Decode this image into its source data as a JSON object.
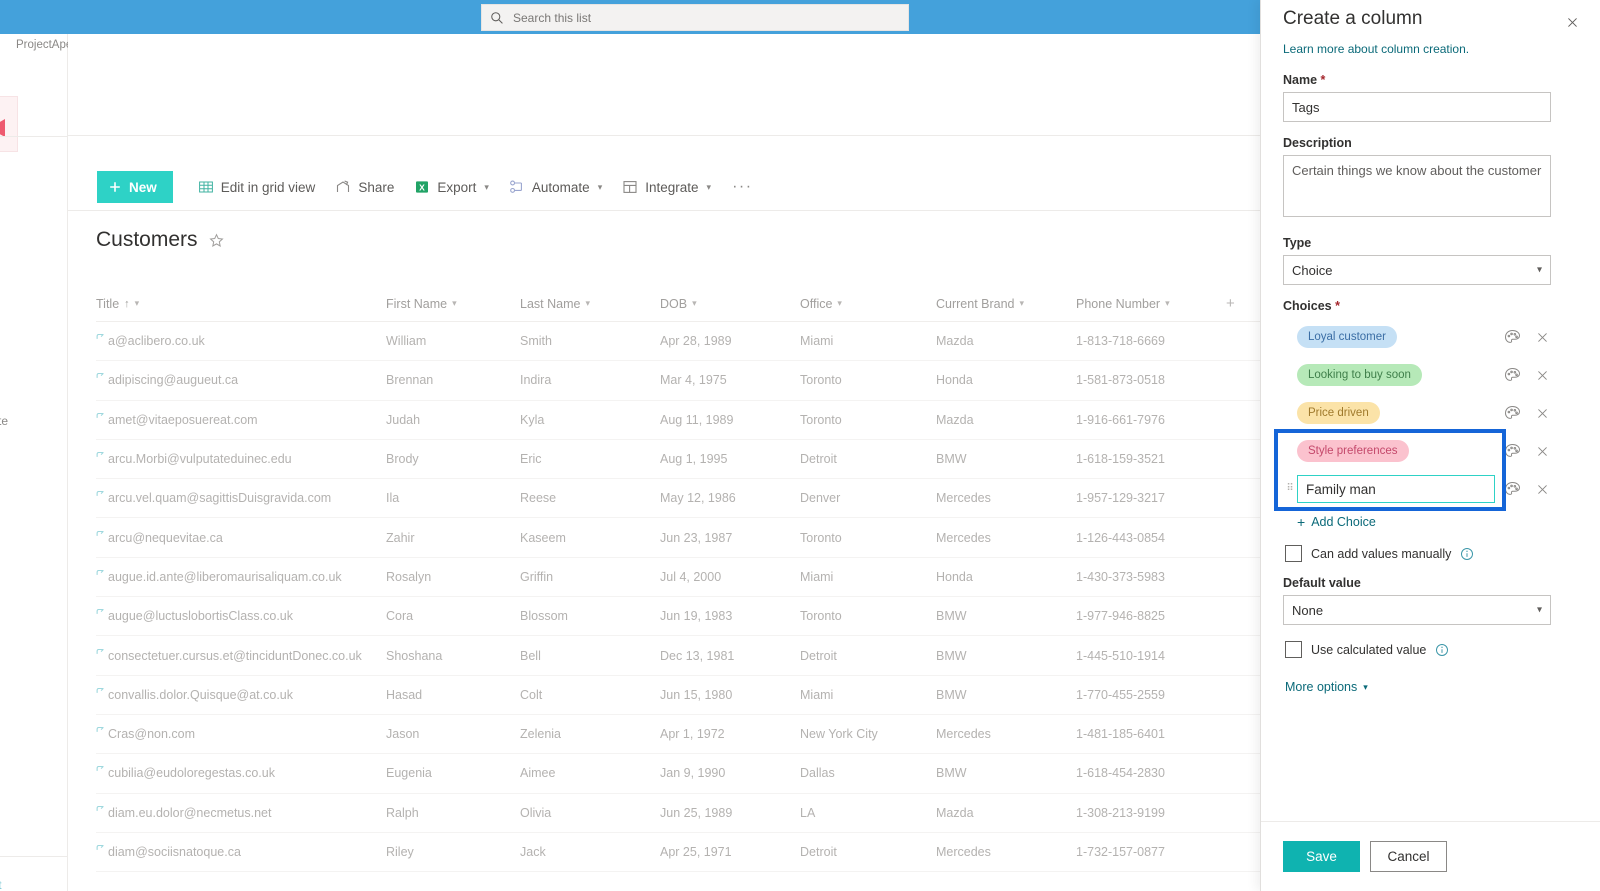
{
  "suite": {
    "search": {
      "placeholder": "Search this list",
      "value": "",
      "icon": "search-icon"
    }
  },
  "sidebar": {
    "site_name": "ProjectApex",
    "clipped_item_1": "mplate",
    "clipped_item_2": "nt"
  },
  "command_bar": {
    "new_label": "New",
    "items": [
      {
        "label": "Edit in grid view",
        "icon": "grid-icon",
        "has_chevron": false
      },
      {
        "label": "Share",
        "icon": "share-icon",
        "has_chevron": false
      },
      {
        "label": "Export",
        "icon": "excel-icon",
        "has_chevron": true
      },
      {
        "label": "Automate",
        "icon": "automate-icon",
        "has_chevron": true
      },
      {
        "label": "Integrate",
        "icon": "integrate-icon",
        "has_chevron": true
      }
    ],
    "overflow_label": "···"
  },
  "list": {
    "title": "Customers",
    "favorite_icon": "star-icon",
    "add_column_label": "+",
    "columns": [
      {
        "label": "Title",
        "sorted": "asc",
        "sort_glyph": "↑"
      },
      {
        "label": "First Name",
        "sorted": "",
        "sort_glyph": ""
      },
      {
        "label": "Last Name",
        "sorted": "",
        "sort_glyph": ""
      },
      {
        "label": "DOB",
        "sorted": "",
        "sort_glyph": ""
      },
      {
        "label": "Office",
        "sorted": "",
        "sort_glyph": ""
      },
      {
        "label": "Current Brand",
        "sorted": "",
        "sort_glyph": ""
      },
      {
        "label": "Phone Number",
        "sorted": "",
        "sort_glyph": ""
      }
    ],
    "rows": [
      {
        "title": "a@aclibero.co.uk",
        "first": "William",
        "last": "Smith",
        "dob": "Apr 28, 1989",
        "office": "Miami",
        "brand": "Mazda",
        "phone": "1-813-718-6669"
      },
      {
        "title": "adipiscing@augueut.ca",
        "first": "Brennan",
        "last": "Indira",
        "dob": "Mar 4, 1975",
        "office": "Toronto",
        "brand": "Honda",
        "phone": "1-581-873-0518"
      },
      {
        "title": "amet@vitaeposuereat.com",
        "first": "Judah",
        "last": "Kyla",
        "dob": "Aug 11, 1989",
        "office": "Toronto",
        "brand": "Mazda",
        "phone": "1-916-661-7976"
      },
      {
        "title": "arcu.Morbi@vulputateduinec.edu",
        "first": "Brody",
        "last": "Eric",
        "dob": "Aug 1, 1995",
        "office": "Detroit",
        "brand": "BMW",
        "phone": "1-618-159-3521"
      },
      {
        "title": "arcu.vel.quam@sagittisDuisgravida.com",
        "first": "Ila",
        "last": "Reese",
        "dob": "May 12, 1986",
        "office": "Denver",
        "brand": "Mercedes",
        "phone": "1-957-129-3217"
      },
      {
        "title": "arcu@nequevitae.ca",
        "first": "Zahir",
        "last": "Kaseem",
        "dob": "Jun 23, 1987",
        "office": "Toronto",
        "brand": "Mercedes",
        "phone": "1-126-443-0854"
      },
      {
        "title": "augue.id.ante@liberomaurisaliquam.co.uk",
        "first": "Rosalyn",
        "last": "Griffin",
        "dob": "Jul 4, 2000",
        "office": "Miami",
        "brand": "Honda",
        "phone": "1-430-373-5983"
      },
      {
        "title": "augue@luctuslobortisClass.co.uk",
        "first": "Cora",
        "last": "Blossom",
        "dob": "Jun 19, 1983",
        "office": "Toronto",
        "brand": "BMW",
        "phone": "1-977-946-8825"
      },
      {
        "title": "consectetuer.cursus.et@tinciduntDonec.co.uk",
        "first": "Shoshana",
        "last": "Bell",
        "dob": "Dec 13, 1981",
        "office": "Detroit",
        "brand": "BMW",
        "phone": "1-445-510-1914"
      },
      {
        "title": "convallis.dolor.Quisque@at.co.uk",
        "first": "Hasad",
        "last": "Colt",
        "dob": "Jun 15, 1980",
        "office": "Miami",
        "brand": "BMW",
        "phone": "1-770-455-2559"
      },
      {
        "title": "Cras@non.com",
        "first": "Jason",
        "last": "Zelenia",
        "dob": "Apr 1, 1972",
        "office": "New York City",
        "brand": "Mercedes",
        "phone": "1-481-185-6401"
      },
      {
        "title": "cubilia@eudoloregestas.co.uk",
        "first": "Eugenia",
        "last": "Aimee",
        "dob": "Jan 9, 1990",
        "office": "Dallas",
        "brand": "BMW",
        "phone": "1-618-454-2830"
      },
      {
        "title": "diam.eu.dolor@necmetus.net",
        "first": "Ralph",
        "last": "Olivia",
        "dob": "Jun 25, 1989",
        "office": "LA",
        "brand": "Mazda",
        "phone": "1-308-213-9199"
      },
      {
        "title": "diam@sociisnatoque.ca",
        "first": "Riley",
        "last": "Jack",
        "dob": "Apr 25, 1971",
        "office": "Detroit",
        "brand": "Mercedes",
        "phone": "1-732-157-0877"
      }
    ]
  },
  "panel": {
    "title": "Create a column",
    "close_icon": "close-icon",
    "learn_more": "Learn more about column creation.",
    "name": {
      "label": "Name",
      "required": "*",
      "value": "Tags",
      "placeholder": ""
    },
    "description": {
      "label": "Description",
      "value": "Certain things we know about the customer",
      "placeholder": ""
    },
    "type": {
      "label": "Type",
      "value": "Choice",
      "chevron": "chevron-down-icon"
    },
    "choices": {
      "label": "Choices",
      "required": "*",
      "palette_icon": "palette-icon",
      "delete_icon": "close-icon",
      "items": [
        {
          "text": "Loyal customer",
          "bg": "#c5e0f5",
          "fg": "#3b6ea5",
          "editing": false
        },
        {
          "text": "Looking to buy soon",
          "bg": "#b6e9b8",
          "fg": "#3f7f4a",
          "editing": false
        },
        {
          "text": "Price driven",
          "bg": "#fbe3a8",
          "fg": "#a07a2c",
          "editing": false
        },
        {
          "text": "Style preferences",
          "bg": "#fbc2ce",
          "fg": "#c4486b",
          "editing": false
        },
        {
          "text": "Family man",
          "bg": "",
          "fg": "",
          "editing": true
        }
      ],
      "add_label": "Add Choice"
    },
    "can_add_manually": {
      "label": "Can add values manually",
      "checked": false,
      "info_icon": "info-icon"
    },
    "default_value": {
      "label": "Default value",
      "value": "None",
      "chevron": "chevron-down-icon"
    },
    "use_calculated": {
      "label": "Use calculated value",
      "checked": false,
      "info_icon": "info-icon"
    },
    "more_options": {
      "label": "More options",
      "chevron": "chevron-down-icon"
    },
    "save_label": "Save",
    "cancel_label": "Cancel",
    "accent_color": "#0fb3b0",
    "focus_outline_color": "#1565d8"
  }
}
